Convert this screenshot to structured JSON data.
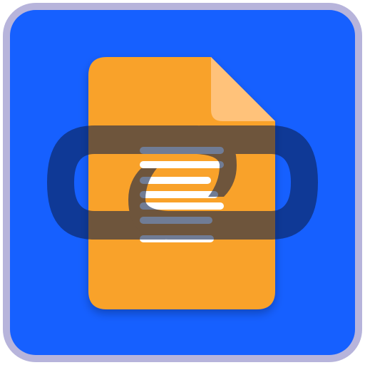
{
  "icon": {
    "semantic": "linked-document-app-icon",
    "colors": {
      "frame": "#B7B4DB",
      "tile": "#1660FF",
      "document": "#F9A22C",
      "document_fold": "#FFC27A",
      "text_lines": "#FFFFFF",
      "chain_link": "#0B1E4A"
    }
  }
}
